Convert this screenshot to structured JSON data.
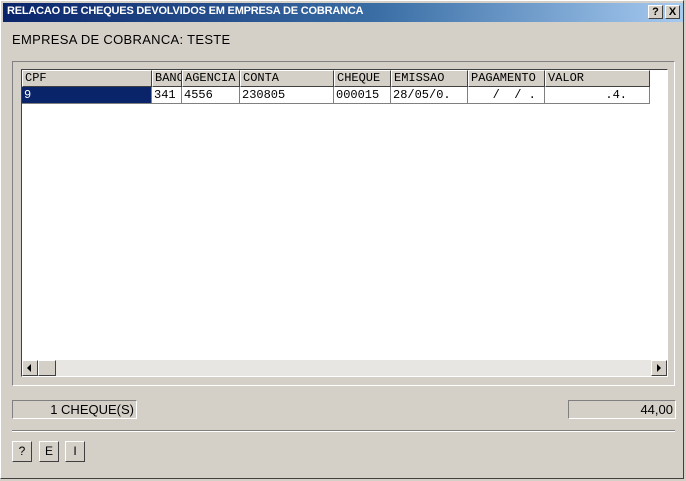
{
  "window": {
    "title": "RELACAO DE CHEQUES DEVOLVIDOS EM EMPRESA DE COBRANCA",
    "help_label": "?",
    "close_label": "X"
  },
  "empresa_label": "EMPRESA DE COBRANCA: TESTE",
  "grid": {
    "columns": [
      "CPF",
      "BANCO",
      "AGENCIA",
      "CONTA",
      "CHEQUE",
      "EMISSAO",
      "PAGAMENTO",
      "VALOR"
    ],
    "rows": [
      [
        "9",
        "341",
        "4556",
        "230805",
        "000015",
        "28/05/0.",
        "  /  / .",
        "  .4."
      ]
    ]
  },
  "footer": {
    "count_label": "1 CHEQUE(S)",
    "total_value": "44,00"
  },
  "buttons": {
    "help": "?",
    "e": "E",
    "i": "I"
  }
}
